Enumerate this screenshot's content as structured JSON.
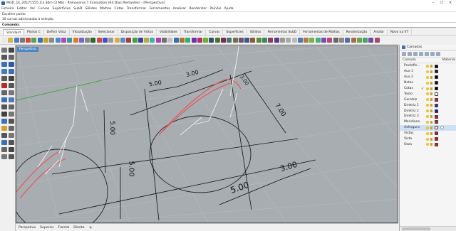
{
  "window": {
    "title": "MGD_1E_20171555_E3.3dm (3 Mb) - Rhinoceros 7 Evaluation (64 Dias Restantes) - [Perspectiva]",
    "controls": [
      "–",
      "☐",
      "✕"
    ]
  },
  "menu": [
    "Ficheiro",
    "Editar",
    "Ver",
    "Curvas",
    "Superfícies",
    "SubD",
    "Sólidos",
    "Malhas",
    "Cotas",
    "Transformar",
    "Ferramentas",
    "Analisar",
    "Renderizar",
    "Painéis",
    "Ajuda"
  ],
  "command_history": [
    "Escolher ponto",
    "16 curvas adicionadas à seleção."
  ],
  "command_line": {
    "label": "Comando:",
    "value": ""
  },
  "toolbar_tabs": [
    "Standard",
    "Planos C",
    "Definir Vista",
    "Visualização",
    "Selecionar",
    "Disposição de Vistas",
    "Visibilidade",
    "Transformar",
    "Curvas",
    "Superfícies",
    "Sólidos",
    "Ferramentas SubD",
    "Ferramentas de Malhas",
    "Renderização",
    "Anotar",
    "Novo na V7"
  ],
  "toolbar_tabs_active": 0,
  "viewport": {
    "name": "Perspetiva",
    "background": "#a8adb2",
    "dimensions": [
      {
        "text": "5.00"
      },
      {
        "text": "3.00"
      },
      {
        "text": "3.00"
      },
      {
        "text": "7.00"
      },
      {
        "text": "5.00"
      },
      {
        "text": "5.00"
      },
      {
        "text": "3.00"
      },
      {
        "text": "5.00"
      }
    ]
  },
  "viewport_tabs": [
    "Perspetiva",
    "Superior",
    "Frontal",
    "Direita",
    "+"
  ],
  "layers_panel": {
    "title": "Camadas",
    "header_name": "Camada",
    "header_material": "Material",
    "layers": [
      {
        "name": "Predefin...",
        "color": "#000000",
        "current": false,
        "selected": false
      },
      {
        "name": "Aux 1",
        "color": "#1a1a1a",
        "current": false,
        "selected": false
      },
      {
        "name": "Aux 2",
        "color": "#000000",
        "current": false,
        "selected": false
      },
      {
        "name": "Notas",
        "color": "#111111",
        "current": false,
        "selected": false
      },
      {
        "name": "Cotas",
        "color": "#000000",
        "current": true,
        "selected": false
      },
      {
        "name": "Texto",
        "color": "#ffffff",
        "current": false,
        "selected": false
      },
      {
        "name": "Geratriz",
        "color": "#e01818",
        "current": false,
        "selected": false
      },
      {
        "name": "Diretriz 1",
        "color": "#2233cc",
        "current": false,
        "selected": false
      },
      {
        "name": "Diretriz 2",
        "color": "#1a1a9a",
        "current": false,
        "selected": false
      },
      {
        "name": "Diretriz 3",
        "color": "#c42020",
        "current": false,
        "selected": false
      },
      {
        "name": "Meridiano",
        "color": "#d62222",
        "current": false,
        "selected": false
      },
      {
        "name": "Asfregura",
        "color": "#ffffff",
        "current": false,
        "selected": true
      },
      {
        "name": "Vistas",
        "color": "#c01f1f",
        "current": false,
        "selected": false
      },
      {
        "name": "Vista",
        "color": "#d21a1a",
        "current": false,
        "selected": false
      },
      {
        "name": "Ozza",
        "color": "#c8202a",
        "current": false,
        "selected": false
      }
    ]
  }
}
